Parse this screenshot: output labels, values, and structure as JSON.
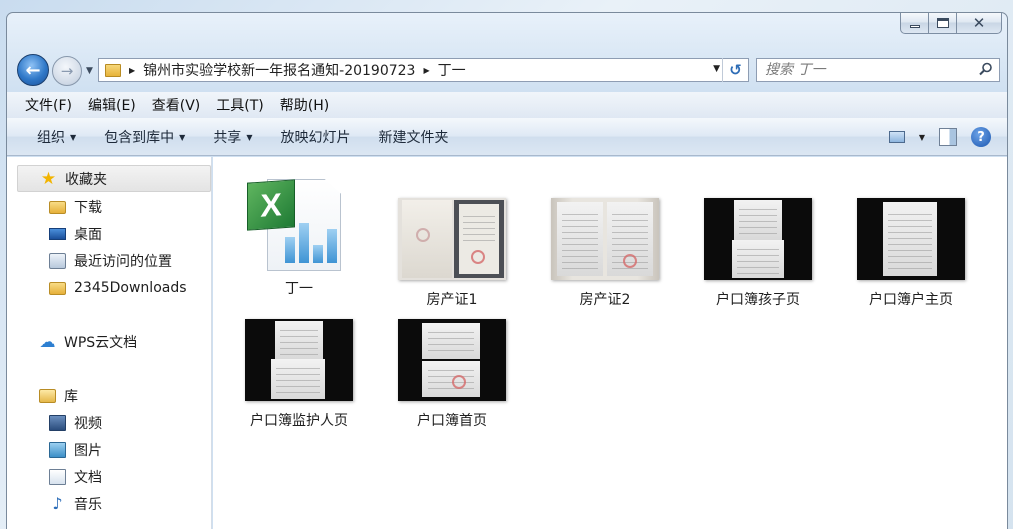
{
  "window": {
    "caption": {
      "minimize": "",
      "maximize": "",
      "close": "✕"
    }
  },
  "address_bar": {
    "crumbs": [
      "锦州市实验学校新一年报名通知-20190723",
      "丁一"
    ]
  },
  "search": {
    "placeholder": "搜索 丁一"
  },
  "menu": {
    "items": [
      "文件(F)",
      "编辑(E)",
      "查看(V)",
      "工具(T)",
      "帮助(H)"
    ]
  },
  "toolbar": {
    "organize": "组织",
    "include_in_library": "包含到库中",
    "share": "共享",
    "slideshow": "放映幻灯片",
    "new_folder": "新建文件夹"
  },
  "nav_pane": {
    "favorites": "收藏夹",
    "downloads": "下载",
    "desktop": "桌面",
    "recent": "最近访问的位置",
    "downloads2345": "2345Downloads",
    "wps_cloud": "WPS云文档",
    "libraries": "库",
    "videos": "视频",
    "pictures": "图片",
    "documents": "文档",
    "music": "音乐"
  },
  "files": [
    {
      "name": "丁一",
      "icon": "excel-file-icon"
    },
    {
      "name": "房产证1",
      "icon": "image-thumbnail"
    },
    {
      "name": "房产证2",
      "icon": "image-thumbnail"
    },
    {
      "name": "户口簿孩子页",
      "icon": "image-thumbnail"
    },
    {
      "name": "户口簿户主页",
      "icon": "image-thumbnail"
    },
    {
      "name": "户口簿监护人页",
      "icon": "image-thumbnail"
    },
    {
      "name": "户口簿首页",
      "icon": "image-thumbnail"
    }
  ],
  "colors": {
    "accent": "#2f78c8",
    "selection": "#e4e4e4"
  }
}
